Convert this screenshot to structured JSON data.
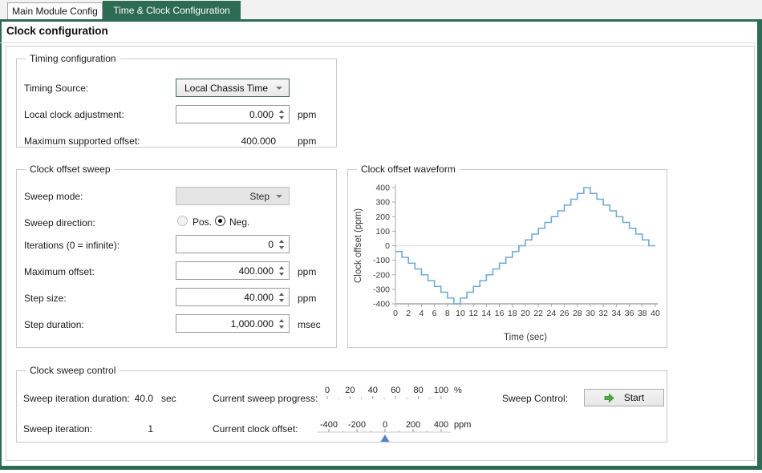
{
  "colors": {
    "accent_green": "#2e6b55",
    "chart_line": "#70aad6",
    "pointer_blue": "#5585c2",
    "start_arrow_green": "#4bae46"
  },
  "icons": {
    "dropdown-arrow": "▼",
    "spin-up": "▲",
    "spin-down": "▼",
    "start-arrow": "➜",
    "offset-pointer": "▲"
  },
  "tabs": [
    {
      "label": "Main Module Config",
      "active": false
    },
    {
      "label": "Time & Clock Configuration",
      "active": true
    }
  ],
  "page_title": "Clock configuration",
  "timing_configuration": {
    "title": "Timing configuration",
    "timing_source_label": "Timing Source:",
    "timing_source_value": "Local Chassis Time",
    "local_clock_adjustment_label": "Local clock adjustment:",
    "local_clock_adjustment_value": "0.000",
    "local_clock_adjustment_unit": "ppm",
    "maximum_supported_offset_label": "Maximum supported offset:",
    "maximum_supported_offset_value": "400.000",
    "maximum_supported_offset_unit": "ppm"
  },
  "clock_offset_sweep": {
    "title": "Clock offset sweep",
    "sweep_mode_label": "Sweep mode:",
    "sweep_mode_value": "Step",
    "sweep_direction_label": "Sweep direction:",
    "direction_options": [
      {
        "label": "Pos.",
        "selected": false
      },
      {
        "label": "Neg.",
        "selected": true
      }
    ],
    "iterations_label": "Iterations (0 = infinite):",
    "iterations_value": "0",
    "maximum_offset_label": "Maximum offset:",
    "maximum_offset_value": "400.000",
    "maximum_offset_unit": "ppm",
    "step_size_label": "Step size:",
    "step_size_value": "40.000",
    "step_size_unit": "ppm",
    "step_duration_label": "Step duration:",
    "step_duration_value": "1,000.000",
    "step_duration_unit": "msec"
  },
  "chart_data": {
    "type": "line",
    "subtype": "staircase-step",
    "title": "Clock offset waveform",
    "xlabel": "Time (sec)",
    "ylabel": "Clock offset (ppm)",
    "xlim": [
      0,
      40
    ],
    "ylim": [
      -400,
      400
    ],
    "x_ticks": [
      0,
      2,
      4,
      6,
      8,
      10,
      12,
      14,
      16,
      18,
      20,
      22,
      24,
      26,
      28,
      30,
      32,
      34,
      36,
      38,
      40
    ],
    "y_ticks": [
      400,
      300,
      200,
      100,
      0,
      -100,
      -200,
      -300,
      -400
    ],
    "grid": false,
    "zero_line": true,
    "step_width_sec": 1,
    "step_values": [
      -40,
      -80,
      -120,
      -160,
      -200,
      -240,
      -280,
      -320,
      -360,
      -400,
      -360,
      -320,
      -280,
      -240,
      -200,
      -160,
      -120,
      -80,
      -40,
      0,
      40,
      80,
      120,
      160,
      200,
      240,
      280,
      320,
      360,
      400,
      360,
      320,
      280,
      240,
      200,
      160,
      120,
      80,
      40,
      0
    ],
    "line_color": "#70aad6"
  },
  "clock_sweep_control": {
    "title": "Clock sweep control",
    "sweep_iteration_duration_label": "Sweep iteration duration:",
    "sweep_iteration_duration_value": "40.0",
    "sweep_iteration_duration_unit": "sec",
    "sweep_iteration_label": "Sweep iteration:",
    "sweep_iteration_value": "1",
    "current_sweep_progress_label": "Current sweep progress:",
    "progress_gauge": {
      "ticks": [
        0,
        20,
        40,
        60,
        80,
        100
      ],
      "unit": "%",
      "pointer_value": null
    },
    "current_clock_offset_label": "Current clock offset:",
    "offset_gauge": {
      "ticks": [
        -400,
        -200,
        0,
        200,
        400
      ],
      "unit": "ppm",
      "pointer_value": 0
    },
    "sweep_control_label": "Sweep Control:",
    "start_button_label": "Start"
  }
}
